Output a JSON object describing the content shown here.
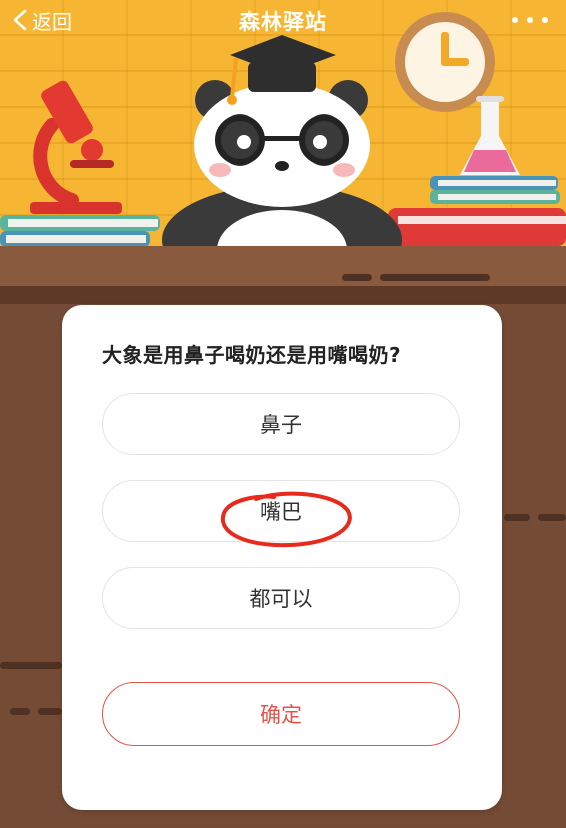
{
  "header": {
    "back_label": "返回",
    "title": "森林驿站",
    "icons": [
      "chevron-left-icon",
      "more-dots-icon"
    ]
  },
  "quiz": {
    "question": "大象是用鼻子喝奶还是用嘴喝奶?",
    "options": [
      {
        "label": "鼻子",
        "selected": false
      },
      {
        "label": "嘴巴",
        "selected": true
      },
      {
        "label": "都可以",
        "selected": false
      }
    ],
    "confirm_label": "确定"
  },
  "colors": {
    "wall": "#f6b633",
    "desk": "#744b35",
    "accent": "#e2534b",
    "annotation": "#e8291c"
  }
}
